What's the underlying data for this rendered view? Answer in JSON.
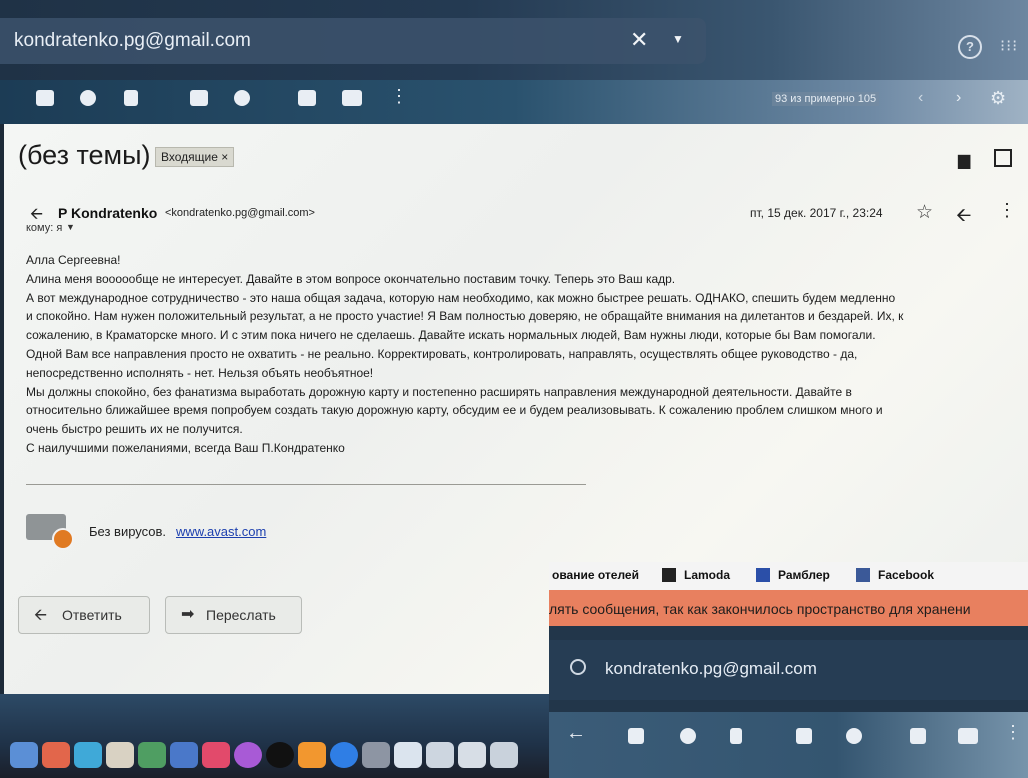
{
  "header": {
    "account": "kondratenko.pg@gmail.com",
    "clear_icon": "close-icon",
    "help_icon": "help-icon",
    "apps_icon": "apps-grid-icon"
  },
  "toolbar": {
    "icons": [
      "archive-icon",
      "report-spam-icon",
      "delete-icon",
      "mark-unread-icon",
      "snooze-icon",
      "move-to-icon",
      "label-icon",
      "more-vert-icon"
    ],
    "count": "93 из примерно 105"
  },
  "email": {
    "subject": "(без темы)",
    "label": "Входящие ×",
    "sender_name": "P Kondratenko",
    "sender_email": "<kondratenko.pg@gmail.com>",
    "to": "кому: я",
    "date": "пт, 15 дек. 2017 г., 23:24",
    "body": [
      "Алла Сергеевна!",
      "Алина меня воооообще не интересует. Давайте в этом вопросе окончательно поставим точку. Теперь это Ваш кадр.",
      "А вот международное сотрудничество - это наша общая задача, которую нам необходимо, как можно быстрее решать. ОДНАКО, спешить будем медленно",
      "и спокойно. Нам нужен положительный результат, а не просто участие! Я Вам полностью доверяю, не обращайте внимания на дилетантов и бездарей. Их, к",
      "сожалению, в Краматорске много. И с этим пока ничего не сделаешь. Давайте искать нормальных людей, Вам нужны люди, которые бы Вам помогали.",
      "Одной Вам все направления просто не охватить - не реально. Корректировать, контролировать, направлять, осуществлять общее руководство - да,",
      "непосредственно исполнять - нет. Нельзя объять необъятное!",
      "Мы должны спокойно, без фанатизма выработать дорожную карту и постепенно расширять направления международной деятельности. Давайте в",
      "относительно ближайшее время попробуем создать такую дорожную карту, обсудим ее и будем реализовывать. К сожалению проблем слишком много и",
      "очень быстро решить их не получится.",
      "С наилучшими пожеланиями, всегда Ваш П.Кондратенко"
    ],
    "avast_text": "Без вирусов.",
    "avast_link": "www.avast.com",
    "reply_label": "Ответить",
    "forward_label": "Переслать"
  },
  "inset": {
    "bookmarks": [
      "ование отелей",
      "Lamoda",
      "Рамблер",
      "Facebook"
    ],
    "storage_warning": "лять сообщения, так как закончилось пространство для хранени",
    "search_account": "kondratenko.pg@gmail.com"
  },
  "colors": {
    "chip_bg": "#d9d9d0",
    "link": "#1c3fae",
    "banner": "#e8805f",
    "avast": "#e07a22"
  }
}
